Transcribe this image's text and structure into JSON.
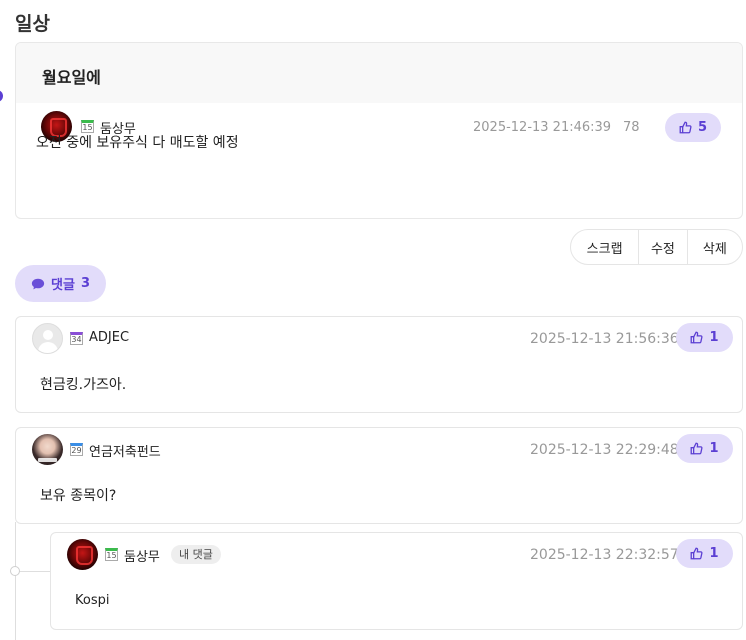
{
  "board": {
    "title": "일상"
  },
  "post": {
    "title": "월요일에",
    "author": {
      "nickname": "둠상무",
      "level": "15"
    },
    "datetime": "2025-12-13 21:46:39",
    "views": "78",
    "likes": "5",
    "body": "오전 중에 보유주식 다 매도할 예정"
  },
  "actions": {
    "scrap": "스크랩",
    "edit": "수정",
    "delete": "삭제"
  },
  "comments_toggle": {
    "label": "댓글",
    "count": "3"
  },
  "comments": [
    {
      "nickname": "ADJEC",
      "level": "34",
      "datetime": "2025-12-13 21:56:36",
      "likes": "1",
      "text": "현금킹.가즈아."
    },
    {
      "nickname": "연금저축펀드",
      "level": "29",
      "datetime": "2025-12-13 22:29:48",
      "likes": "1",
      "text": "보유 종목이?"
    },
    {
      "nickname": "둠상무",
      "level": "15",
      "badge": "내 댓글",
      "datetime": "2025-12-13 22:32:57",
      "likes": "1",
      "text": "Kospi"
    }
  ],
  "icons": {
    "like": "thumbs-up-icon",
    "comment": "speech-bubble-icon",
    "level": "level-badge-icon"
  },
  "colors": {
    "accent": "#5b3fd3",
    "accent_bg": "#e2dcfa",
    "level_green": "#3bbb4c",
    "level_purple": "#8a4fd6",
    "level_blue": "#3a8ee6"
  }
}
